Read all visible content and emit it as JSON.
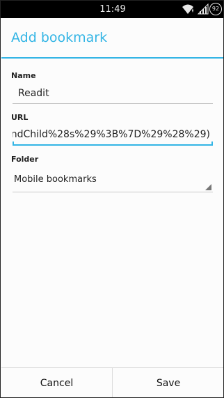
{
  "status_bar": {
    "time": "11:49",
    "battery_level": "92",
    "wifi_icon": "wifi-icon",
    "signal_icon": "signal-icon"
  },
  "dialog": {
    "title": "Add bookmark",
    "accent_color": "#33b5e5"
  },
  "name_field": {
    "label": "Name",
    "value": "Readit"
  },
  "url_field": {
    "label": "URL",
    "value": "ndChild%28s%29%3B%7D%29%28%29)"
  },
  "folder_field": {
    "label": "Folder",
    "selected": "Mobile bookmarks"
  },
  "buttons": {
    "cancel": "Cancel",
    "save": "Save"
  }
}
